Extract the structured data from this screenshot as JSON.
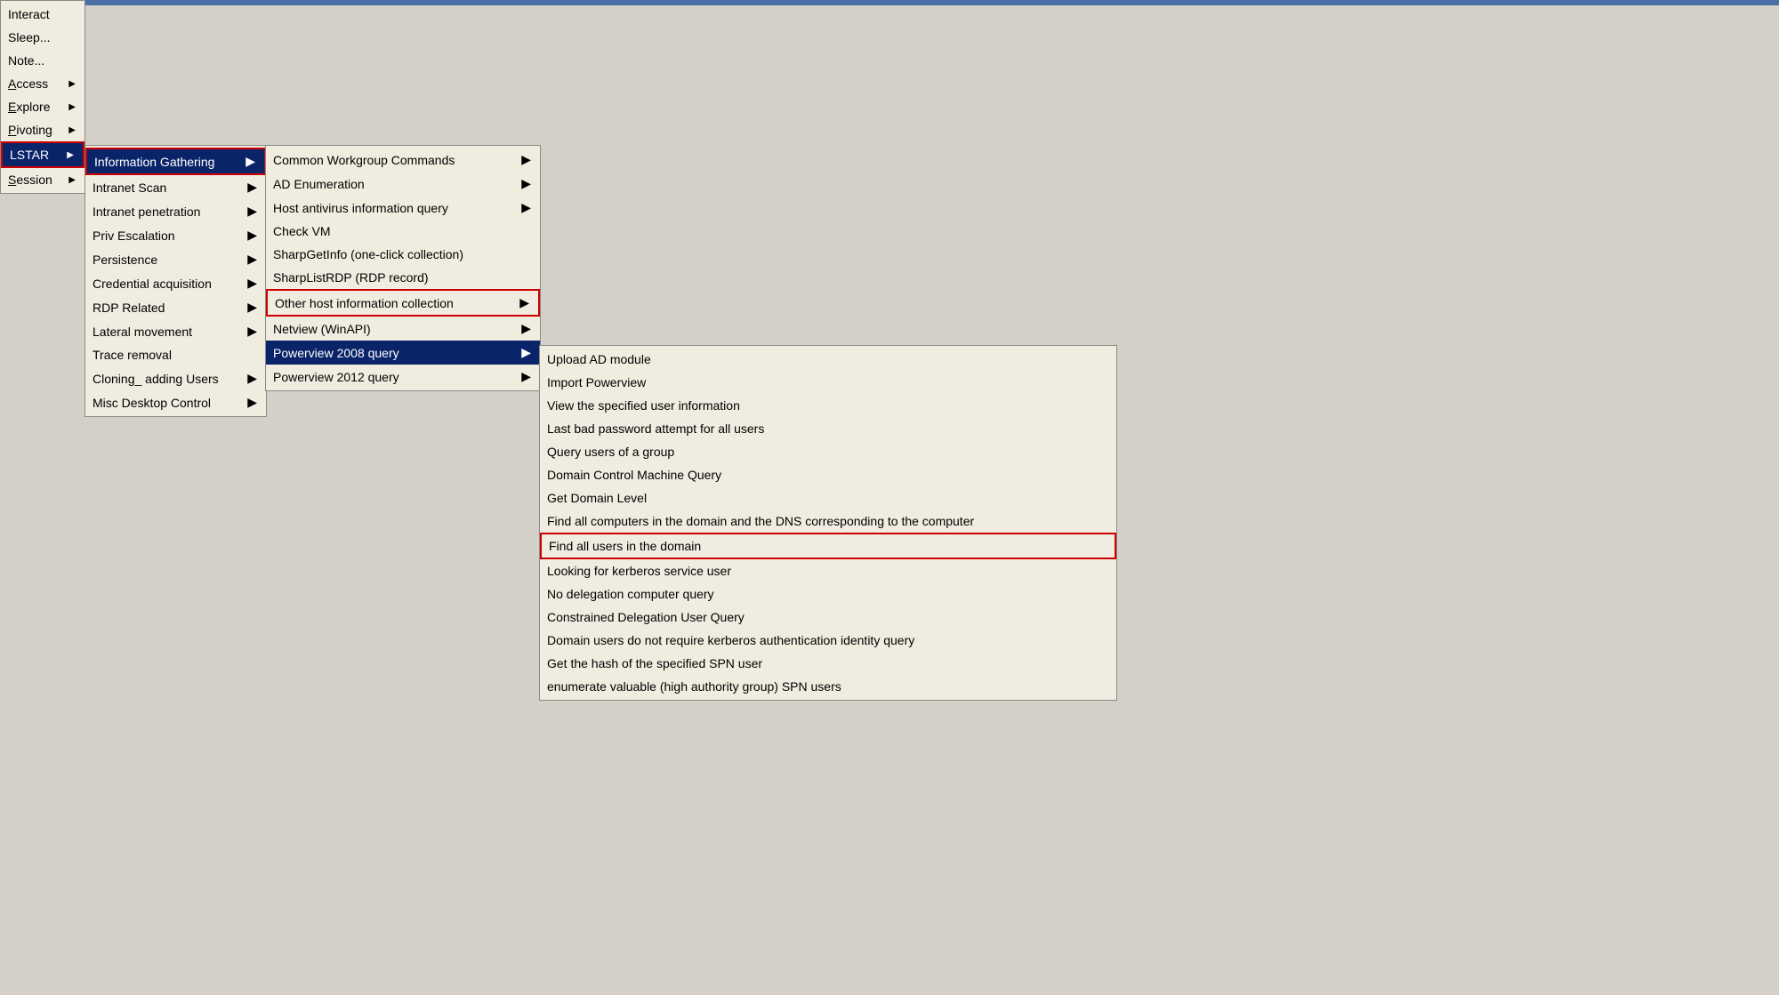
{
  "topbar": {
    "color": "#4a6fa5"
  },
  "mainMenu": {
    "items": [
      {
        "label": "Interact",
        "underline": "I",
        "hasSubmenu": false,
        "active": false
      },
      {
        "label": "Sleep...",
        "underline": "S",
        "hasSubmenu": false,
        "active": false
      },
      {
        "label": "Note...",
        "underline": "N",
        "hasSubmenu": false,
        "active": false
      },
      {
        "label": "Access",
        "underline": "A",
        "hasSubmenu": true,
        "active": false
      },
      {
        "label": "Explore",
        "underline": "E",
        "hasSubmenu": true,
        "active": false
      },
      {
        "label": "Pivoting",
        "underline": "P",
        "hasSubmenu": true,
        "active": false
      },
      {
        "label": "LSTAR",
        "underline": "L",
        "hasSubmenu": true,
        "active": true,
        "highlighted": true
      },
      {
        "label": "Session",
        "underline": "S",
        "hasSubmenu": true,
        "active": false
      }
    ]
  },
  "submenuL2": {
    "label": "Information Gathering",
    "items": [
      {
        "label": "Information Gathering",
        "hasSubmenu": true,
        "active": true,
        "highlighted": true
      },
      {
        "label": "Intranet Scan",
        "hasSubmenu": true,
        "active": false
      },
      {
        "label": "Intranet penetration",
        "hasSubmenu": true,
        "active": false
      },
      {
        "label": "Priv Escalation",
        "hasSubmenu": true,
        "active": false
      },
      {
        "label": "Persistence",
        "hasSubmenu": true,
        "active": false
      },
      {
        "label": "Credential acquisition",
        "hasSubmenu": true,
        "active": false
      },
      {
        "label": "RDP Related",
        "hasSubmenu": true,
        "active": false
      },
      {
        "label": "Lateral movement",
        "hasSubmenu": true,
        "active": false
      },
      {
        "label": "Trace removal",
        "hasSubmenu": false,
        "active": false
      },
      {
        "label": "Cloning_ adding Users",
        "hasSubmenu": true,
        "active": false
      },
      {
        "label": "Misc Desktop Control",
        "hasSubmenu": true,
        "active": false
      }
    ]
  },
  "submenuL3": {
    "items": [
      {
        "label": "Common Workgroup Commands",
        "hasSubmenu": true,
        "active": false
      },
      {
        "label": "AD Enumeration",
        "hasSubmenu": true,
        "active": false
      },
      {
        "label": "Host antivirus information query",
        "hasSubmenu": true,
        "active": false
      },
      {
        "label": "Check VM",
        "hasSubmenu": false,
        "active": false
      },
      {
        "label": "SharpGetInfo (one-click collection)",
        "hasSubmenu": false,
        "active": false
      },
      {
        "label": "SharpListRDP (RDP record)",
        "hasSubmenu": false,
        "active": false
      },
      {
        "label": "Other host information collection",
        "hasSubmenu": true,
        "active": false,
        "highlighted": false
      },
      {
        "label": "Netview (WinAPI)",
        "hasSubmenu": true,
        "active": false
      },
      {
        "label": "Powerview 2008 query",
        "hasSubmenu": true,
        "active": true
      },
      {
        "label": "Powerview 2012 query",
        "hasSubmenu": true,
        "active": false
      }
    ]
  },
  "submenuL4": {
    "items": [
      {
        "label": "Upload AD module",
        "hasSubmenu": false,
        "active": false
      },
      {
        "label": "Import Powerview",
        "hasSubmenu": false,
        "active": false
      },
      {
        "label": "View the specified user information",
        "hasSubmenu": false,
        "active": false
      },
      {
        "label": "Last bad password attempt for all users",
        "hasSubmenu": false,
        "active": false
      },
      {
        "label": "Query users of a group",
        "hasSubmenu": false,
        "active": false
      },
      {
        "label": "Domain Control Machine Query",
        "hasSubmenu": false,
        "active": false
      },
      {
        "label": "Get Domain Level",
        "hasSubmenu": false,
        "active": false
      },
      {
        "label": "Find all computers in the domain and the DNS corresponding to the computer",
        "hasSubmenu": false,
        "active": false
      },
      {
        "label": "Find all users in the domain",
        "hasSubmenu": false,
        "active": false,
        "highlighted": true
      },
      {
        "label": "Looking for kerberos service user",
        "hasSubmenu": false,
        "active": false
      },
      {
        "label": "No delegation computer query",
        "hasSubmenu": false,
        "active": false
      },
      {
        "label": "Constrained Delegation User Query",
        "hasSubmenu": false,
        "active": false
      },
      {
        "label": "Domain users do not require kerberos authentication identity query",
        "hasSubmenu": false,
        "active": false
      },
      {
        "label": "Get the hash of the specified SPN user",
        "hasSubmenu": false,
        "active": false
      },
      {
        "label": "enumerate valuable (high authority group) SPN users",
        "hasSubmenu": false,
        "active": false
      }
    ]
  }
}
